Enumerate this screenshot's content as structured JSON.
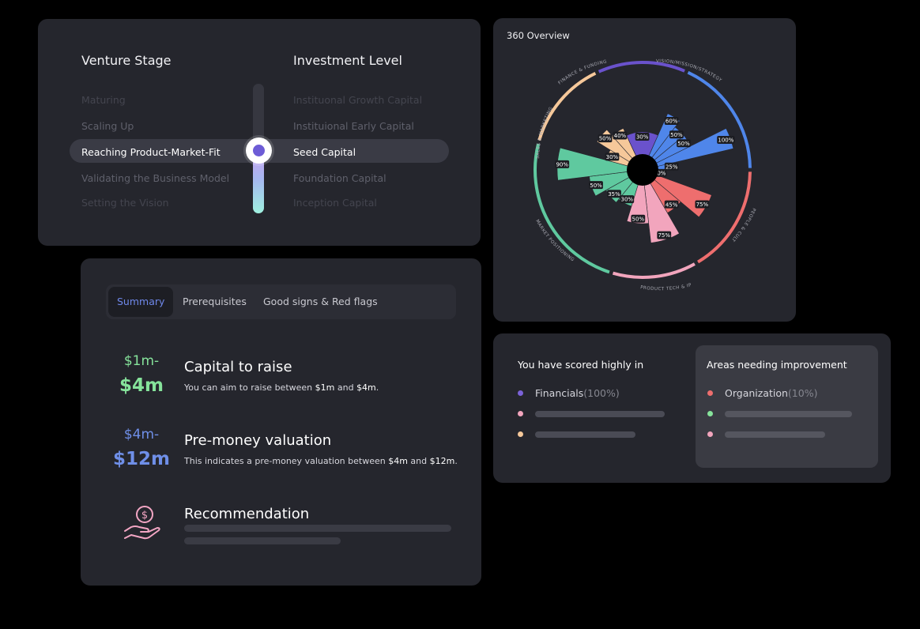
{
  "stage": {
    "venture_title": "Venture Stage",
    "investment_title": "Investment Level",
    "venture_options": [
      "Maturing",
      "Scaling Up",
      "Reaching Product-Market-Fit",
      "Validating the Business Model",
      "Setting the Vision"
    ],
    "investment_options": [
      "Instituonal Growth Capital",
      "Instituional Early Capital",
      "Seed Capital",
      "Foundation Capital",
      "Inception Capital"
    ],
    "selected_index": 2
  },
  "summary": {
    "tabs": [
      "Summary",
      "Prerequisites",
      "Good signs & Red flags"
    ],
    "active_tab": 0,
    "capital": {
      "range_low": "$1m-",
      "range_high": "$4m",
      "title": "Capital to raise",
      "desc_prefix": "You can aim to raise between ",
      "desc_low": "$1m",
      "desc_mid": " and ",
      "desc_high": "$4m",
      "desc_suffix": "."
    },
    "valuation": {
      "range_low": "$4m-",
      "range_high": "$12m",
      "title": "Pre-money valuation",
      "desc_prefix": "This indicates a pre-money valuation between ",
      "desc_low": "$4m",
      "desc_mid": " and ",
      "desc_high": "$12m",
      "desc_suffix": "."
    },
    "recommendation": {
      "title": "Recommendation",
      "icon": "money-hand-icon"
    },
    "colors": {
      "capital": "#86e39b",
      "valuation": "#6f8fe8",
      "icon": "#f3a6c4"
    }
  },
  "overview": {
    "title": "360 Overview",
    "chart_data": {
      "type": "polar-area",
      "categories": [
        {
          "name": "VISION/MISSION/STRATEGY",
          "color": "#4f86ea",
          "bars": [
            60,
            50,
            50,
            100,
            25
          ],
          "labels": [
            "60%",
            "50%",
            "50%",
            "100%",
            "25%"
          ]
        },
        {
          "name": "PEOPLE & CULTURE",
          "color": "#ee6e6e",
          "bars": [
            10,
            75,
            45
          ],
          "labels": [
            "10%",
            "75%",
            "45%"
          ]
        },
        {
          "name": "PRODUCT TECH & IP",
          "color": "#f2a5bd",
          "bars": [
            75,
            50
          ],
          "labels": [
            "75%",
            "50%"
          ]
        },
        {
          "name": "MARKET POSITIONING",
          "color": "#5fc99f",
          "bars": [
            30,
            35,
            50,
            90
          ],
          "labels": [
            "30%",
            "35%",
            "50%",
            "90%"
          ]
        },
        {
          "name": "SALES & MARKETING",
          "color": "#f6c89a",
          "bars": [
            30,
            50,
            40
          ],
          "labels": [
            "30%",
            "50%",
            "40%"
          ]
        },
        {
          "name": "FINANCE & FUNDING",
          "color": "#6a52cc",
          "bars": [
            30
          ],
          "labels": [
            "30%"
          ]
        }
      ],
      "rlim": [
        0,
        100
      ]
    }
  },
  "scores": {
    "high_title": "You have scored highly in",
    "improve_title": "Areas needing improvement",
    "high_items": [
      {
        "label": "Financials",
        "pct": "(100%)",
        "color": "#7b62d8"
      },
      {
        "color": "#f2a5bd"
      },
      {
        "color": "#f6c89a"
      }
    ],
    "improve_items": [
      {
        "label": "Organization",
        "pct": "(10%)",
        "color": "#ee6e6e"
      },
      {
        "color": "#86e39b"
      },
      {
        "color": "#f2a5bd"
      }
    ]
  }
}
